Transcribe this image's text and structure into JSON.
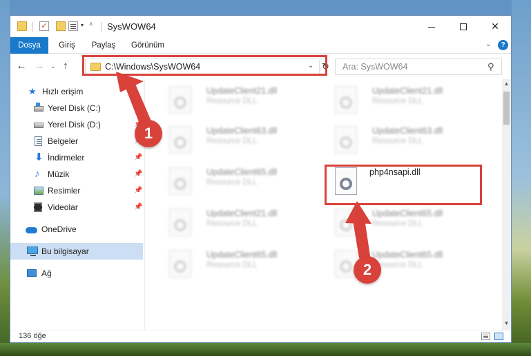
{
  "titlebar": {
    "title": "SysWOW64",
    "quick_access_icons": [
      "folder-icon",
      "properties-check-icon",
      "new-folder-icon",
      "properties-icon"
    ]
  },
  "ribbon": {
    "tabs": [
      {
        "label": "Dosya",
        "active": true
      },
      {
        "label": "Giriş"
      },
      {
        "label": "Paylaş"
      },
      {
        "label": "Görünüm"
      }
    ],
    "help_label": "?"
  },
  "address": {
    "path": "C:\\Windows\\SysWOW64",
    "search_placeholder": "Ara: SysWOW64"
  },
  "sidebar": {
    "items": [
      {
        "label": "Hızlı erişim",
        "icon": "star-icon"
      },
      {
        "label": "Yerel Disk (C:)",
        "icon": "drive-icon",
        "pinned": true
      },
      {
        "label": "Yerel Disk (D:)",
        "icon": "drive-icon",
        "pinned": true
      },
      {
        "label": "Belgeler",
        "icon": "documents-icon",
        "pinned": true
      },
      {
        "label": "İndirmeler",
        "icon": "downloads-icon",
        "pinned": true
      },
      {
        "label": "Müzik",
        "icon": "music-icon",
        "pinned": true
      },
      {
        "label": "Resimler",
        "icon": "pictures-icon",
        "pinned": true
      },
      {
        "label": "Videolar",
        "icon": "videos-icon",
        "pinned": true
      },
      {
        "label": "OneDrive",
        "icon": "onedrive-icon"
      },
      {
        "label": "Bu bilgisayar",
        "icon": "computer-icon",
        "selected": true
      },
      {
        "label": "Ağ",
        "icon": "network-icon"
      }
    ]
  },
  "files": [
    {
      "name": "UpdateClient21.dll",
      "type": "Resource DLL"
    },
    {
      "name": "UpdateClient21.dll",
      "type": "Resource DLL"
    },
    {
      "name": "UpdateClient63.dll",
      "type": "Resource DLL"
    },
    {
      "name": "UpdateClient63.dll",
      "type": "Resource DLL"
    },
    {
      "name": "UpdateClient65.dll",
      "type": "Resource DLL"
    },
    {
      "name": "php4nsapi.dll",
      "type": "",
      "highlighted": true
    },
    {
      "name": "UpdateClient21.dll",
      "type": "Resource DLL"
    },
    {
      "name": "UpdateClient65.dll",
      "type": "Resource DLL"
    },
    {
      "name": "UpdateClient65.dll",
      "type": "Resource DLL"
    },
    {
      "name": "UpdateClient65.dll",
      "type": "Resource DLL"
    }
  ],
  "status": {
    "count": "136 öğe"
  },
  "annotations": {
    "step1": "1",
    "step2": "2",
    "color": "#d9413b"
  }
}
